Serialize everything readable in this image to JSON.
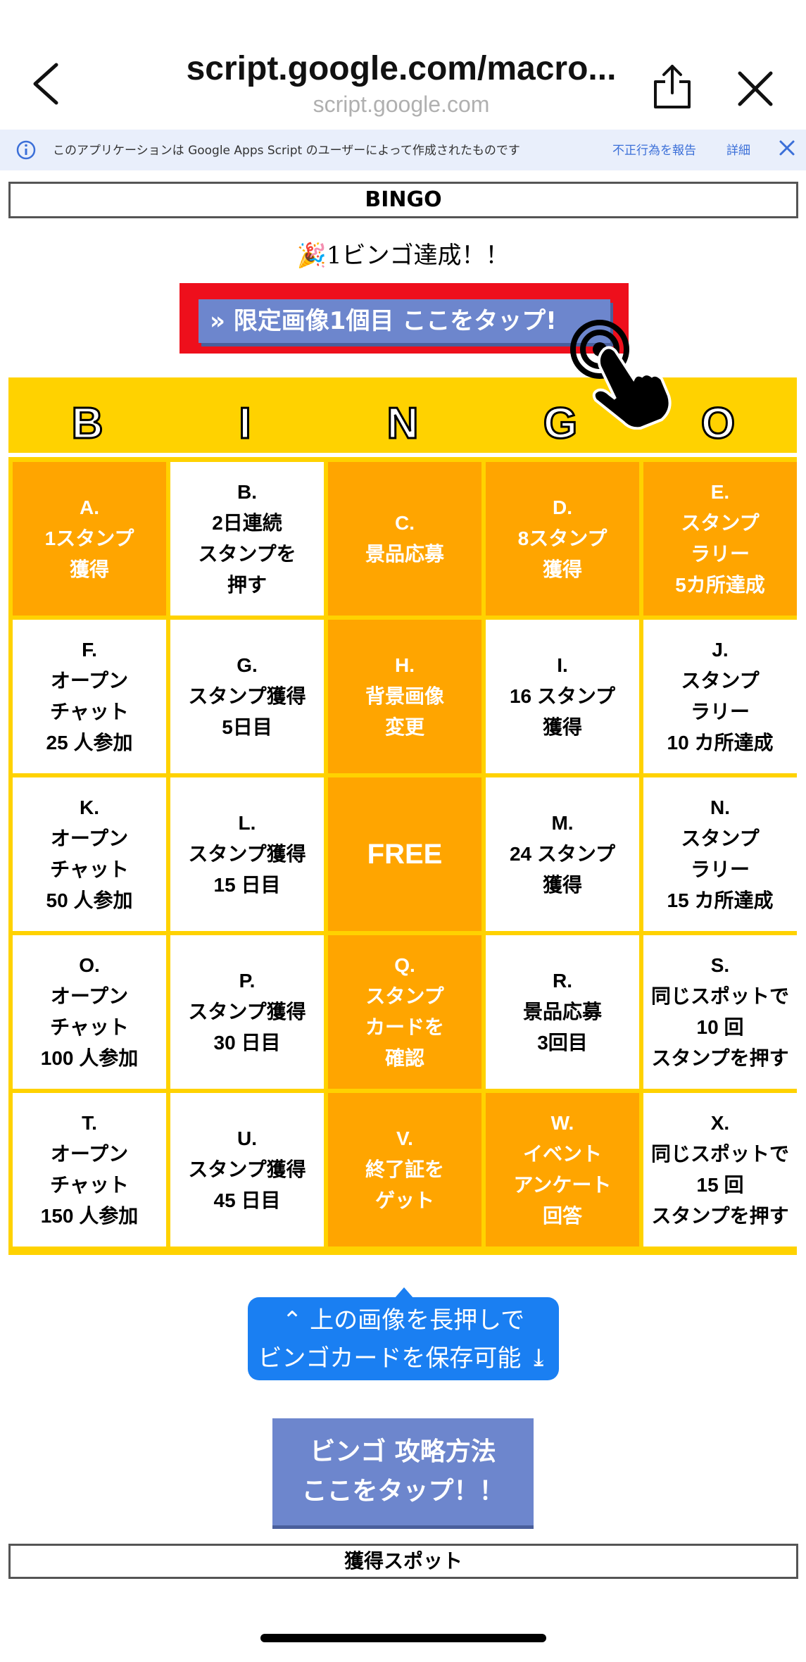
{
  "nav": {
    "url_title": "script.google.com/macro...",
    "url_subtitle": "script.google.com"
  },
  "banner": {
    "text": "このアプリケーションは Google Apps Script のユーザーによって作成されたものです",
    "report": "不正行為を報告",
    "detail": "詳細"
  },
  "bingo_title": "BINGO",
  "achievement": "🎉1ビンゴ達成！！",
  "limited_button": "» 限定画像1個目 ここをタップ!",
  "letters": [
    "B",
    "I",
    "N",
    "G",
    "O"
  ],
  "cells": [
    {
      "text": "A.\n1スタンプ\n獲得",
      "style": "orange"
    },
    {
      "text": "B.\n2日連続\nスタンプを\n押す",
      "style": "white"
    },
    {
      "text": "C.\n景品応募",
      "style": "orange"
    },
    {
      "text": "D.\n8スタンプ\n獲得",
      "style": "orange"
    },
    {
      "text": "E.\nスタンプ\nラリー\n5カ所達成",
      "style": "orange"
    },
    {
      "text": "F.\nオープン\nチャット\n25 人参加",
      "style": "white"
    },
    {
      "text": "G.\nスタンプ獲得\n5日目",
      "style": "white"
    },
    {
      "text": "H.\n背景画像\n変更",
      "style": "orange"
    },
    {
      "text": "I.\n16 スタンプ\n獲得",
      "style": "white"
    },
    {
      "text": "J.\nスタンプ\nラリー\n10 カ所達成",
      "style": "white"
    },
    {
      "text": "K.\nオープン\nチャット\n50 人参加",
      "style": "white"
    },
    {
      "text": "L.\nスタンプ獲得\n15 日目",
      "style": "white"
    },
    {
      "text": "FREE",
      "style": "orange free"
    },
    {
      "text": "M.\n24 スタンプ\n獲得",
      "style": "white"
    },
    {
      "text": "N.\nスタンプ\nラリー\n15 カ所達成",
      "style": "white"
    },
    {
      "text": "O.\nオープン\nチャット\n100 人参加",
      "style": "white"
    },
    {
      "text": "P.\nスタンプ獲得\n30 日目",
      "style": "white"
    },
    {
      "text": "Q.\nスタンプ\nカードを\n確認",
      "style": "orange"
    },
    {
      "text": "R.\n景品応募\n3回目",
      "style": "white"
    },
    {
      "text": "S.\n同じスポットで\n10 回\nスタンプを押す",
      "style": "white"
    },
    {
      "text": "T.\nオープン\nチャット\n150 人参加",
      "style": "white"
    },
    {
      "text": "U.\nスタンプ獲得\n45 日目",
      "style": "white"
    },
    {
      "text": "V.\n終了証を\nゲット",
      "style": "orange"
    },
    {
      "text": "W.\nイベント\nアンケート\n回答",
      "style": "orange"
    },
    {
      "text": "X.\n同じスポットで\n15 回\nスタンプを押す",
      "style": "white"
    }
  ],
  "save_tip": {
    "line1": "上の画像を長押しで",
    "line2": "ビンゴカードを保存可能"
  },
  "strategy_button": {
    "line1": "ビンゴ 攻略方法",
    "line2": "ここをタップ！！"
  },
  "spots_title": "獲得スポット",
  "colors": {
    "grid_yellow": "#ffd200",
    "cell_orange": "#ffa500",
    "button_blue": "#6d86cd",
    "tip_blue": "#1a7ff2",
    "highlight_red": "#ee0f1c"
  }
}
